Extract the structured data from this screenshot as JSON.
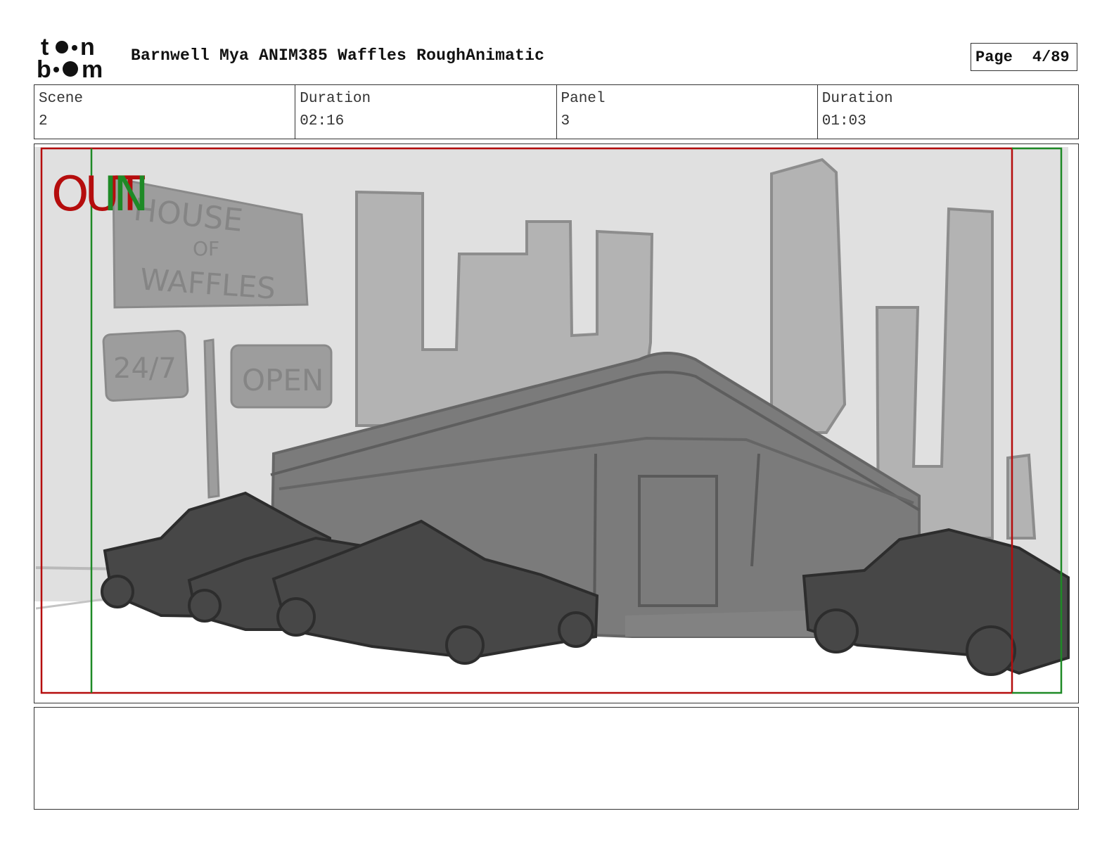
{
  "header": {
    "logo_text": "toon boom",
    "title": "Barnwell Mya ANIM385 Waffles RoughAnimatic",
    "page_label": "Page",
    "page_value": "4/89"
  },
  "info": {
    "scene_label": "Scene",
    "scene_value": "2",
    "scene_duration_label": "Duration",
    "scene_duration_value": "02:16",
    "panel_label": "Panel",
    "panel_value": "3",
    "panel_duration_label": "Duration",
    "panel_duration_value": "01:03"
  },
  "panel": {
    "out_marker": "OUT",
    "in_marker": "IN",
    "sign_house_line1": "HOUSE",
    "sign_house_line2": "OF",
    "sign_house_line3": "WAFFLES",
    "sign_24_7": "24/7",
    "sign_open": "OPEN",
    "colors": {
      "out_frame": "#b50d0d",
      "in_frame": "#1e8a26",
      "sky": "#e0e0e0",
      "buildings": "#b3b3b3",
      "diner": "#7b7b7b",
      "cars": "#474747",
      "signs": "#9d9d9d"
    }
  },
  "notes": {
    "text": ""
  }
}
